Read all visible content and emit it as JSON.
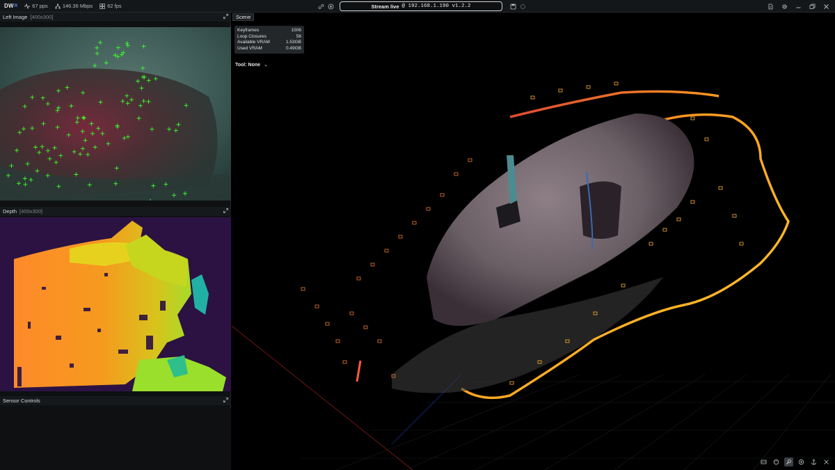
{
  "topbar": {
    "logo": "DW",
    "logo_sup": "R",
    "stats": [
      {
        "icon": "activity-icon",
        "value": "67 pps"
      },
      {
        "icon": "network-icon",
        "value": "146.36 Mbps"
      },
      {
        "icon": "grid-icon",
        "value": "62 fps"
      }
    ],
    "stream_prefix": "Stream live",
    "stream_address": "@ 192.168.1.190  v1.2.2"
  },
  "panels": {
    "left_image": {
      "title": "Left Image",
      "size": "[400x300]"
    },
    "depth": {
      "title": "Depth",
      "size": "[400x300]"
    },
    "sensor_controls": {
      "title": "Sensor Controls"
    }
  },
  "scene": {
    "tab": "Scene",
    "stats": [
      {
        "label": "Keyframes",
        "value": "1506"
      },
      {
        "label": "Loop Closures",
        "value": "56"
      },
      {
        "label": "Available VRAM",
        "value": "1.53GB"
      },
      {
        "label": "Used VRAM",
        "value": "0.49GB"
      }
    ],
    "tool": "Tool: None"
  },
  "colors": {
    "feature_marker": "#39ff2a",
    "depth_bg": "#2b1243",
    "trajectory_hot": "#ffd028",
    "trajectory_cool": "#d22a3a"
  }
}
